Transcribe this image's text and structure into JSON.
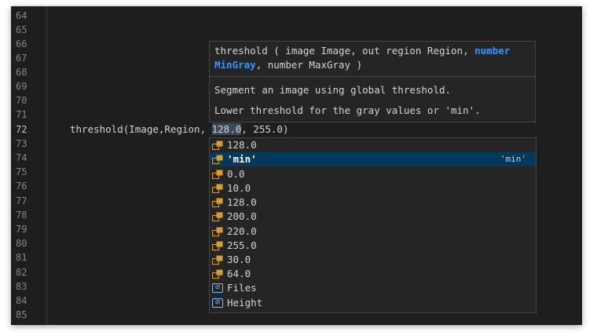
{
  "gutter": {
    "lines": [
      "64",
      "65",
      "66",
      "67",
      "68",
      "69",
      "70",
      "71",
      "72",
      "73",
      "74",
      "75",
      "76",
      "77",
      "78",
      "79",
      "80",
      "81",
      "82",
      "83",
      "84",
      "85"
    ],
    "current_line": "72"
  },
  "code": {
    "before": "threshold(Image,Region, ",
    "selected": "128.0",
    "after": ", 255.0)"
  },
  "hover": {
    "sig_prefix": "threshold ( image Image, out region Region, ",
    "sig_param": "number MinGray",
    "sig_suffix": ", number MaxGray )",
    "doc_line1": "Segment an image using global threshold.",
    "doc_line2": "Lower threshold for the gray values or 'min'."
  },
  "suggest": {
    "items": [
      {
        "label": "128.0",
        "icon": "value-icon",
        "detail": ""
      },
      {
        "label": "'min'",
        "icon": "value-icon",
        "detail": "'min'"
      },
      {
        "label": "0.0",
        "icon": "value-icon",
        "detail": ""
      },
      {
        "label": "10.0",
        "icon": "value-icon",
        "detail": ""
      },
      {
        "label": "128.0",
        "icon": "value-icon",
        "detail": ""
      },
      {
        "label": "200.0",
        "icon": "value-icon",
        "detail": ""
      },
      {
        "label": "220.0",
        "icon": "value-icon",
        "detail": ""
      },
      {
        "label": "255.0",
        "icon": "value-icon",
        "detail": ""
      },
      {
        "label": "30.0",
        "icon": "value-icon",
        "detail": ""
      },
      {
        "label": "64.0",
        "icon": "value-icon",
        "detail": ""
      },
      {
        "label": "Files",
        "icon": "variable-icon",
        "detail": ""
      },
      {
        "label": "Height",
        "icon": "variable-icon",
        "detail": ""
      }
    ],
    "selected_index": 1
  },
  "colors": {
    "editor_bg": "#1e1e1e",
    "widget_bg": "#252526",
    "selection": "#04395e",
    "param_highlight": "#3794ff",
    "value_icon": "#d6a02c",
    "variable_icon": "#75beff"
  }
}
